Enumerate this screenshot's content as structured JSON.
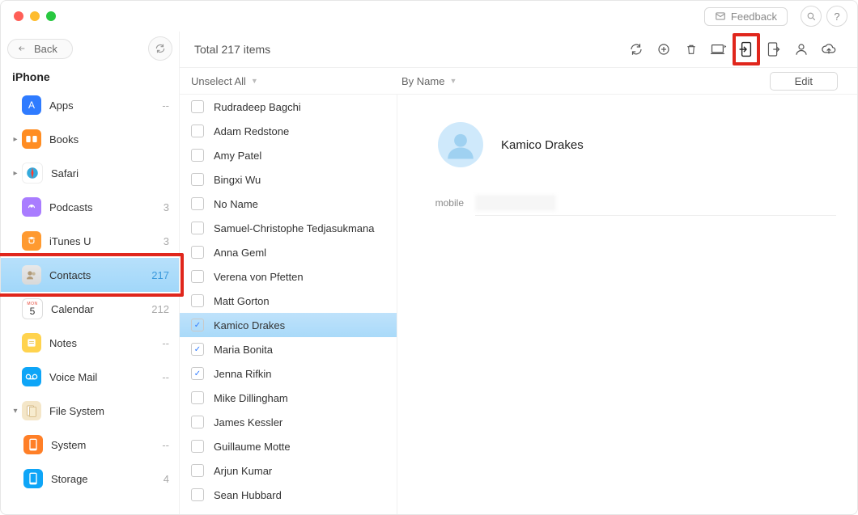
{
  "topbar": {
    "feedback_label": "Feedback"
  },
  "sidebar": {
    "back_label": "Back",
    "device_title": "iPhone",
    "items": [
      {
        "label": "Apps",
        "count": "--"
      },
      {
        "label": "Books",
        "count": ""
      },
      {
        "label": "Safari",
        "count": ""
      },
      {
        "label": "Podcasts",
        "count": "3"
      },
      {
        "label": "iTunes U",
        "count": "3"
      },
      {
        "label": "Contacts",
        "count": "217"
      },
      {
        "label": "Calendar",
        "count": "212"
      },
      {
        "label": "Notes",
        "count": "--"
      },
      {
        "label": "Voice Mail",
        "count": "--"
      },
      {
        "label": "File System",
        "count": ""
      },
      {
        "label": "System",
        "count": "--"
      },
      {
        "label": "Storage",
        "count": "4"
      }
    ],
    "calendar_day": "5"
  },
  "toolbar": {
    "total_label": "Total 217 items"
  },
  "list": {
    "unselect_label": "Unselect All",
    "sort_label": "By Name",
    "edit_label": "Edit",
    "rows": [
      {
        "name": "Rudradeep Bagchi",
        "checked": false,
        "selected": false
      },
      {
        "name": "Adam Redstone",
        "checked": false,
        "selected": false
      },
      {
        "name": "Amy Patel",
        "checked": false,
        "selected": false
      },
      {
        "name": "Bingxi Wu",
        "checked": false,
        "selected": false
      },
      {
        "name": "No Name",
        "checked": false,
        "selected": false
      },
      {
        "name": "Samuel-Christophe Tedjasukmana",
        "checked": false,
        "selected": false
      },
      {
        "name": "Anna Geml",
        "checked": false,
        "selected": false
      },
      {
        "name": "Verena von Pfetten",
        "checked": false,
        "selected": false
      },
      {
        "name": "Matt Gorton",
        "checked": false,
        "selected": false
      },
      {
        "name": "Kamico Drakes",
        "checked": true,
        "selected": true
      },
      {
        "name": "Maria Bonita",
        "checked": true,
        "selected": false
      },
      {
        "name": "Jenna Rifkin",
        "checked": true,
        "selected": false
      },
      {
        "name": "Mike Dillingham",
        "checked": false,
        "selected": false
      },
      {
        "name": "James Kessler",
        "checked": false,
        "selected": false
      },
      {
        "name": "Guillaume Motte",
        "checked": false,
        "selected": false
      },
      {
        "name": "Arjun Kumar",
        "checked": false,
        "selected": false
      },
      {
        "name": "Sean Hubbard",
        "checked": false,
        "selected": false
      }
    ]
  },
  "details": {
    "name": "Kamico  Drakes",
    "fields": [
      {
        "label": "mobile",
        "value": ""
      }
    ]
  }
}
